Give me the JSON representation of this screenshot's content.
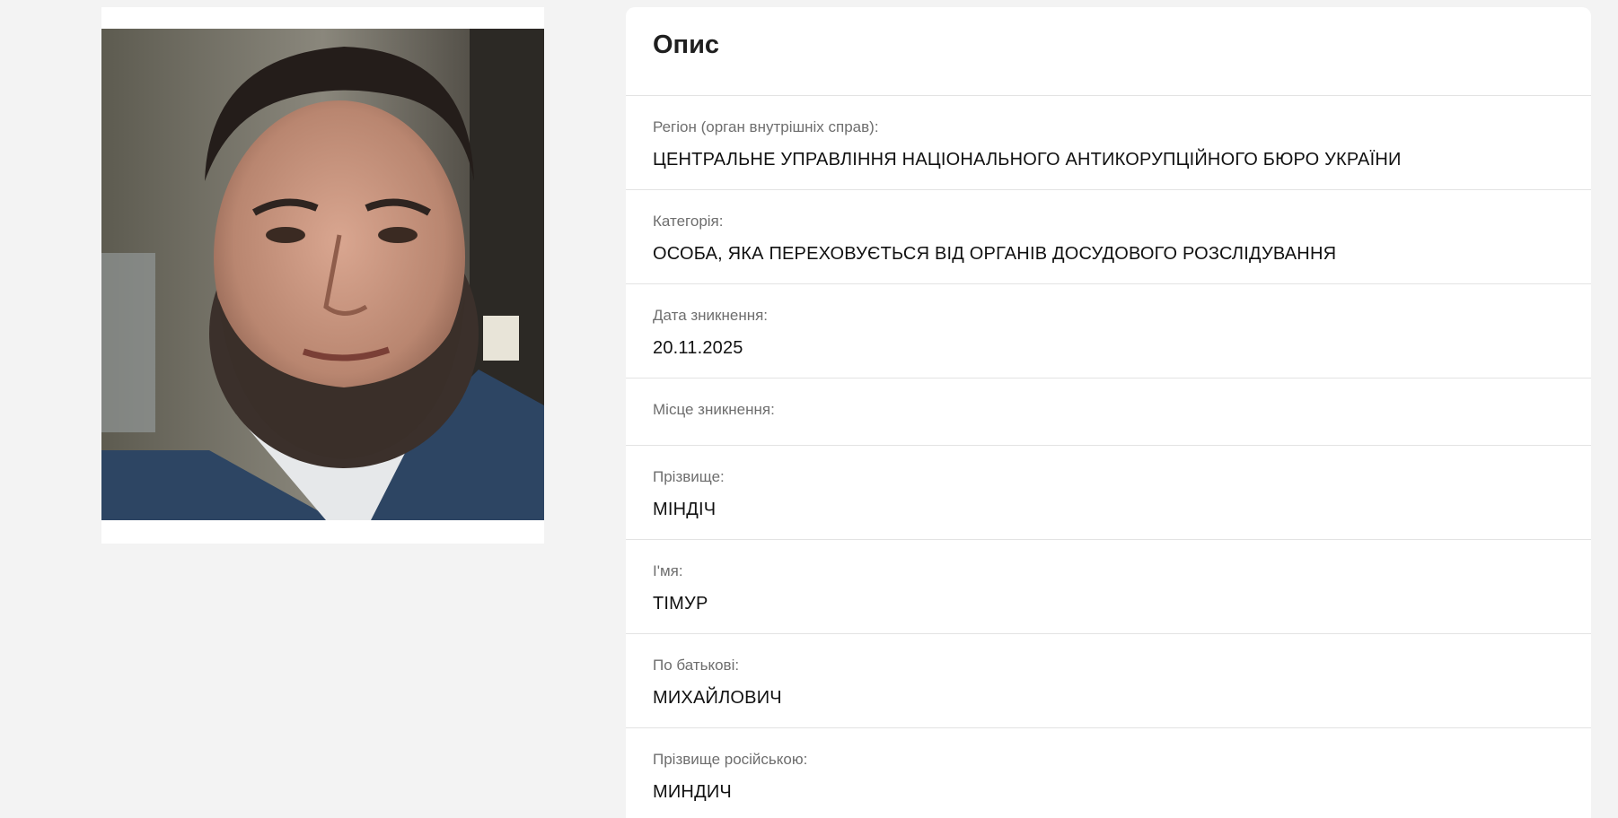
{
  "photo": {
    "alt": "Фото особи"
  },
  "description": {
    "title": "Опис",
    "fields": [
      {
        "label": "Регіон (орган внутрішніх справ):",
        "value": "ЦЕНТРАЛЬНЕ УПРАВЛІННЯ НАЦІОНАЛЬНОГО АНТИКОРУПЦІЙНОГО БЮРО УКРАЇНИ"
      },
      {
        "label": "Категорія:",
        "value": "ОСОБА, ЯКА ПЕРЕХОВУЄТЬСЯ ВІД ОРГАНІВ ДОСУДОВОГО РОЗСЛІДУВАННЯ"
      },
      {
        "label": "Дата зникнення:",
        "value": "20.11.2025"
      },
      {
        "label": "Місце зникнення:",
        "value": ""
      },
      {
        "label": "Прізвище:",
        "value": "МІНДІЧ"
      },
      {
        "label": "І'мя:",
        "value": "ТІМУР"
      },
      {
        "label": "По батькові:",
        "value": "МИХАЙЛОВИЧ"
      },
      {
        "label": "Прізвище російською:",
        "value": "МИНДИЧ"
      }
    ]
  },
  "colors": {
    "background": "#f3f3f3",
    "card": "#ffffff",
    "label": "#6e6e6e",
    "value": "#111111"
  }
}
